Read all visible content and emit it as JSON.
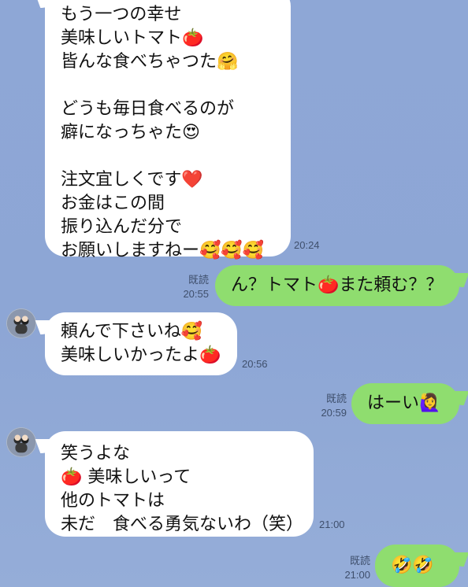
{
  "messages": [
    {
      "id": "m1",
      "side": "incoming",
      "text": "もう一つの幸せ\n美味しいトマト🍅\n皆んな食べちゃつた🤗\n\nどうも毎日食べるのが\n癖になっちゃた😍\n\n注文宜しくです❤️\nお金はこの間\n振り込んだ分で\nお願いしますねー🥰🥰🥰",
      "time": "20:24"
    },
    {
      "id": "m2",
      "side": "outgoing",
      "text": "ん？トマト🍅また頼む？？",
      "read": "既読",
      "time": "20:55"
    },
    {
      "id": "m3",
      "side": "incoming",
      "text": "頼んで下さいね🥰\n美味しいかったよ🍅",
      "time": "20:56"
    },
    {
      "id": "m4",
      "side": "outgoing",
      "text": "はーい🙋‍♀️",
      "read": "既読",
      "time": "20:59"
    },
    {
      "id": "m5",
      "side": "incoming",
      "text": "笑うよな\n🍅 美味しいって\n他のトマトは\n未だ　食べる勇気ないわ（笑）",
      "time": "21:00"
    },
    {
      "id": "m6",
      "side": "outgoing",
      "text": "🤣🤣",
      "read": "既読",
      "time": "21:00"
    }
  ]
}
